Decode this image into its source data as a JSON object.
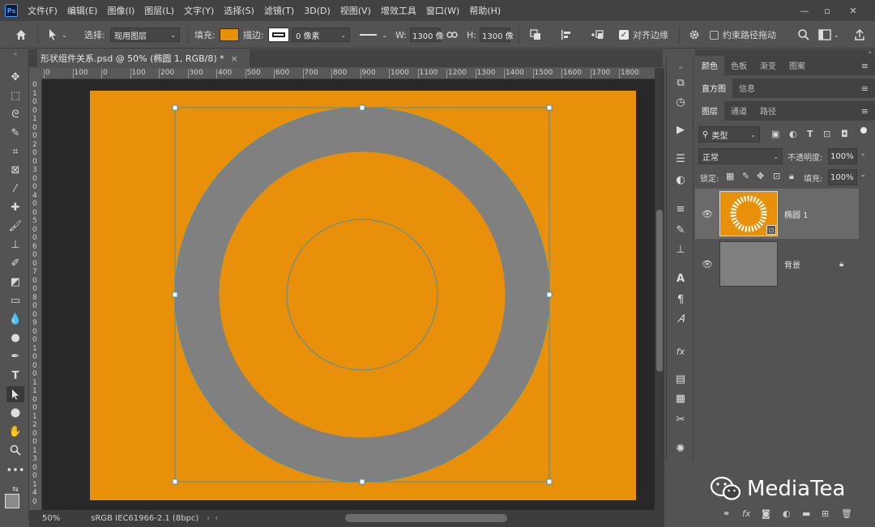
{
  "app": {
    "logo_text": "Ps",
    "menu": [
      "文件(F)",
      "编辑(E)",
      "图像(I)",
      "图层(L)",
      "文字(Y)",
      "选择(S)",
      "滤镜(T)",
      "3D(D)",
      "视图(V)",
      "增效工具",
      "窗口(W)",
      "帮助(H)"
    ],
    "window_controls": [
      "—",
      "▫",
      "✕"
    ]
  },
  "options": {
    "select_label": "选择:",
    "select_value": "现用图层",
    "fill_label": "填充:",
    "fill_color": "#e8900a",
    "stroke_label": "描边:",
    "stroke_width": "0 像素",
    "w_label": "W:",
    "w_value": "1300 像",
    "h_label": "H:",
    "h_value": "1300 像",
    "align_edges_label": "对齐边缘",
    "constrain_path_label": "约束路径拖动"
  },
  "document": {
    "tab_title": "形状组件关系.psd @ 50% (椭圆 1, RGB/8) *",
    "tab_close": "×",
    "background_color": "#e8900a",
    "ring_color": "#808080",
    "path_color": "#4a8fb0"
  },
  "ruler": {
    "h_ticks": [
      "0",
      "100",
      "0",
      "100",
      "200",
      "300",
      "400",
      "500",
      "600",
      "700",
      "800",
      "900",
      "1000",
      "1100",
      "1200",
      "1300",
      "1400",
      "1500",
      "1600",
      "1700",
      "1800"
    ],
    "v_ticks": [
      "0",
      "1",
      "0",
      "0",
      "1",
      "0",
      "0",
      "2",
      "0",
      "0",
      "3",
      "0",
      "0",
      "4",
      "0",
      "0",
      "5",
      "0",
      "0",
      "6",
      "0",
      "0",
      "7",
      "0",
      "0",
      "8",
      "0",
      "0",
      "9",
      "0",
      "0",
      "1",
      "0",
      "0",
      "0",
      "1",
      "1",
      "0",
      "0",
      "1",
      "2",
      "0",
      "0",
      "1",
      "3",
      "0",
      "0",
      "1",
      "4",
      "0"
    ]
  },
  "status": {
    "zoom": "50%",
    "profile": "sRGB IEC61966-2.1 (8bpc)"
  },
  "panels": {
    "top_tabs": [
      "颜色",
      "色板",
      "渐变",
      "图案"
    ],
    "mid_tabs": [
      "直方图",
      "信息"
    ],
    "layer_tabs": [
      "图层",
      "通道",
      "路径"
    ],
    "filter_kind": "类型",
    "blend_mode": "正常",
    "opacity_label": "不透明度:",
    "opacity_value": "100%",
    "lock_label": "锁定:",
    "fill_label": "填充:",
    "fill_value": "100%",
    "layers": [
      {
        "name": "椭圆 1"
      },
      {
        "name": "背景"
      }
    ]
  },
  "watermark": {
    "text": "MediaTea"
  }
}
